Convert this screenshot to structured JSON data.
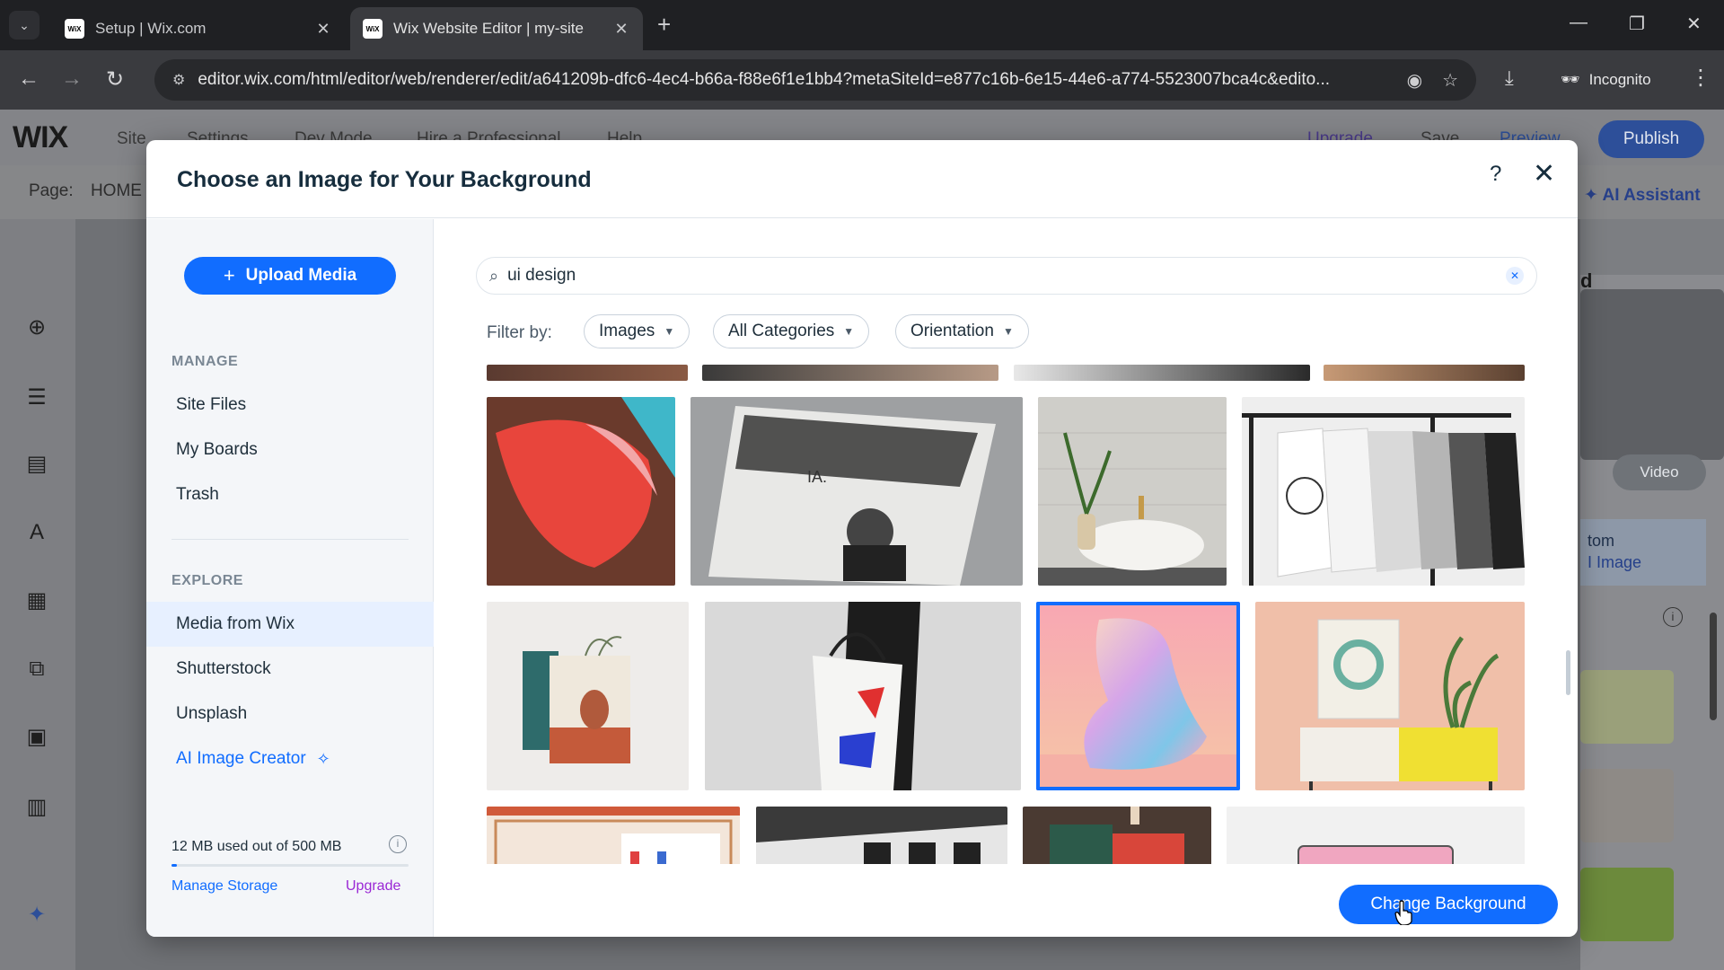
{
  "browser": {
    "tabs": [
      {
        "title": "Setup | Wix.com",
        "favicon": "WiX",
        "active": false
      },
      {
        "title": "Wix Website Editor | my-site",
        "favicon": "WiX",
        "active": true
      }
    ],
    "url": "editor.wix.com/html/editor/web/renderer/edit/a641209b-dfc6-4ec4-b66a-f88e6f1e1bb4?metaSiteId=e877c16b-6e15-44e6-a774-5523007bca4c&edito...",
    "incognito_label": "Incognito"
  },
  "editor": {
    "logo": "WIX",
    "menu": [
      "Site",
      "Settings",
      "Dev Mode",
      "Hire a Professional",
      "Help"
    ],
    "top_right": [
      "Upgrade",
      "Save",
      "Preview"
    ],
    "publish_label": "Publish",
    "page_label": "Page:",
    "page_name": "HOME",
    "ai_assistant_label": "AI Assistant",
    "panel_partial_labels": [
      "d",
      "Video",
      "tom",
      "I Image"
    ]
  },
  "modal": {
    "title": "Choose an Image for Your Background",
    "help_label": "?",
    "upload_label": "Upload Media",
    "manage_section": "MANAGE",
    "manage_items": [
      "Site Files",
      "My Boards",
      "Trash"
    ],
    "explore_section": "EXPLORE",
    "explore_items": [
      "Media from Wix",
      "Shutterstock",
      "Unsplash",
      "AI Image Creator"
    ],
    "selected_explore": "Media from Wix",
    "storage_text": "12 MB used out of 500 MB",
    "storage_fraction": 0.024,
    "manage_storage_label": "Manage Storage",
    "upgrade_label": "Upgrade",
    "search_value": "ui design",
    "filter_label": "Filter by:",
    "filters": [
      "Images",
      "All Categories",
      "Orientation"
    ],
    "change_button_label": "Change Background"
  },
  "colors": {
    "accent": "#116dff",
    "upgrade": "#9a27d5",
    "selected_bg": "#e7f0ff"
  }
}
